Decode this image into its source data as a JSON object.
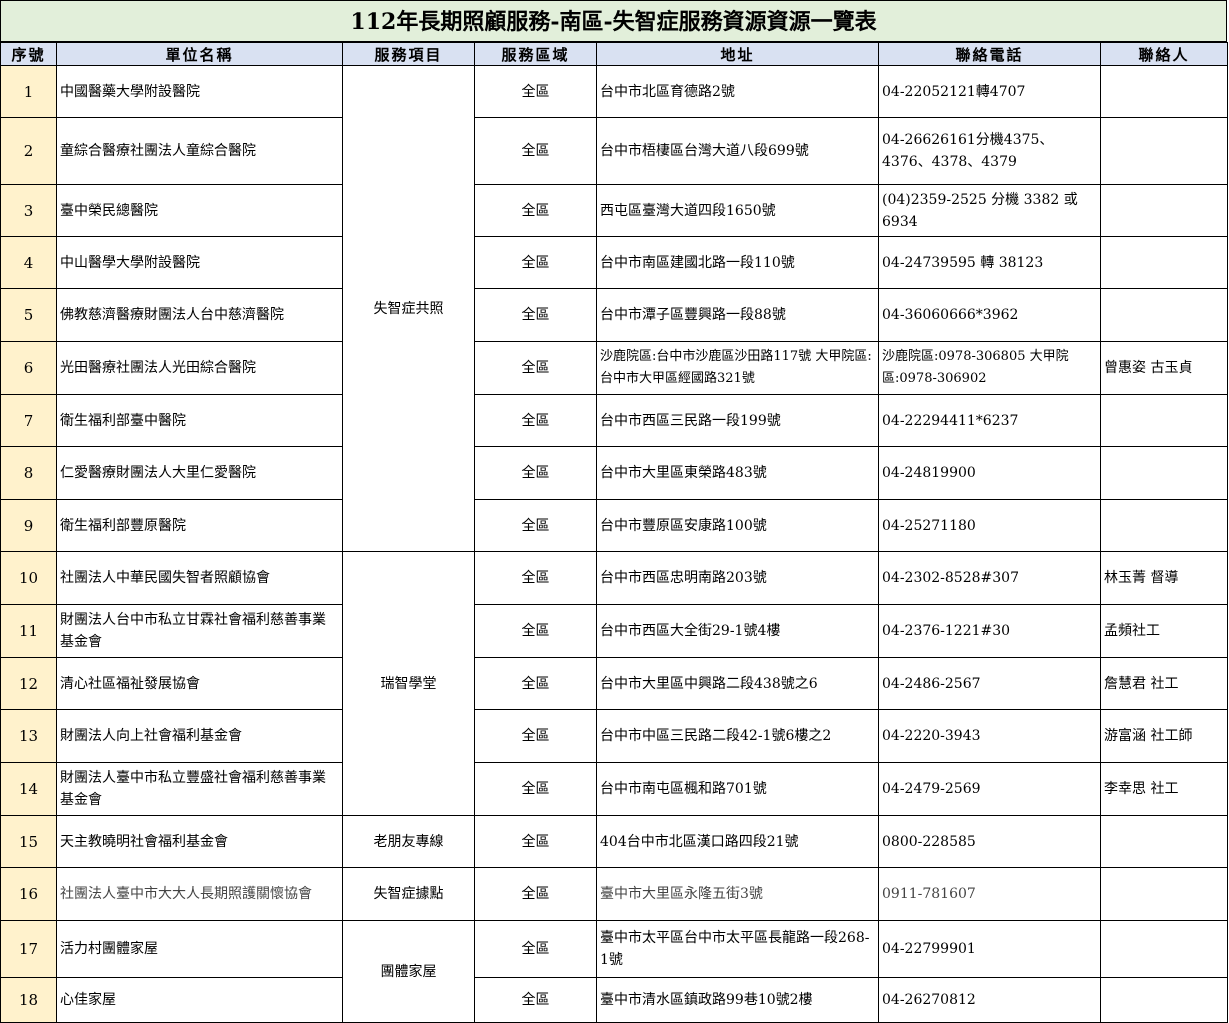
{
  "title": "112年長期照顧服務-南區-失智症服務資源資源一覽表",
  "headers": {
    "seq": "序號",
    "unit": "單位名稱",
    "service": "服務項目",
    "area": "服務區域",
    "address": "地址",
    "phone": "聯絡電話",
    "contact": "聯絡人"
  },
  "services": {
    "group1": "失智症共照",
    "group2": "瑞智學堂",
    "group3": "老朋友專線",
    "group4": "失智症據點",
    "group5": "團體家屋"
  },
  "rows": [
    {
      "seq": "1",
      "unit": "中國醫藥大學附設醫院",
      "area": "全區",
      "address": "台中市北區育德路2號",
      "phone": "04-22052121轉4707",
      "contact": ""
    },
    {
      "seq": "2",
      "unit": "童綜合醫療社團法人童綜合醫院",
      "area": "全區",
      "address": "台中市梧棲區台灣大道八段699號",
      "phone": "04-26626161分機4375、4376、4378、4379",
      "contact": ""
    },
    {
      "seq": "3",
      "unit": "臺中榮民總醫院",
      "area": "全區",
      "address": "西屯區臺灣大道四段1650號",
      "phone": "(04)2359-2525 分機 3382 或 6934",
      "contact": ""
    },
    {
      "seq": "4",
      "unit": "中山醫學大學附設醫院",
      "area": "全區",
      "address": "台中市南區建國北路一段110號",
      "phone": "04-24739595 轉 38123",
      "contact": ""
    },
    {
      "seq": "5",
      "unit": "佛教慈濟醫療財團法人台中慈濟醫院",
      "area": "全區",
      "address": "台中市潭子區豐興路一段88號",
      "phone": "04-36060666*3962",
      "contact": ""
    },
    {
      "seq": "6",
      "unit": "光田醫療社團法人光田綜合醫院",
      "area": "全區",
      "address": "沙鹿院區:台中市沙鹿區沙田路117號 大甲院區:台中市大甲區經國路321號",
      "phone": "沙鹿院區:0978-306805 大甲院區:0978-306902",
      "contact": "曾惠姿 古玉貞"
    },
    {
      "seq": "7",
      "unit": "衛生福利部臺中醫院",
      "area": "全區",
      "address": "台中市西區三民路一段199號",
      "phone": "04-22294411*6237",
      "contact": ""
    },
    {
      "seq": "8",
      "unit": "仁愛醫療財團法人大里仁愛醫院",
      "area": "全區",
      "address": "台中市大里區東榮路483號",
      "phone": "04-24819900",
      "contact": ""
    },
    {
      "seq": "9",
      "unit": "衛生福利部豐原醫院",
      "area": "全區",
      "address": "台中市豐原區安康路100號",
      "phone": "04-25271180",
      "contact": ""
    },
    {
      "seq": "10",
      "unit": "社團法人中華民國失智者照顧協會",
      "area": "全區",
      "address": "台中市西區忠明南路203號",
      "phone": "04-2302-8528#307",
      "contact": "林玉菁 督導"
    },
    {
      "seq": "11",
      "unit": "財團法人台中市私立甘霖社會福利慈善事業基金會",
      "area": "全區",
      "address": "台中市西區大全街29-1號4樓",
      "phone": "04-2376-1221#30",
      "contact": "孟頻社工"
    },
    {
      "seq": "12",
      "unit": "清心社區福祉發展協會",
      "area": "全區",
      "address": "台中市大里區中興路二段438號之6",
      "phone": "04-2486-2567",
      "contact": "詹慧君 社工"
    },
    {
      "seq": "13",
      "unit": "財團法人向上社會福利基金會",
      "area": "全區",
      "address": "台中市中區三民路二段42-1號6樓之2",
      "phone": "04-2220-3943",
      "contact": "游富涵 社工師"
    },
    {
      "seq": "14",
      "unit": "財團法人臺中市私立豐盛社會福利慈善事業基金會",
      "area": "全區",
      "address": "台中市南屯區楓和路701號",
      "phone": "04-2479-2569",
      "contact": "李幸思 社工"
    },
    {
      "seq": "15",
      "unit": "天主教曉明社會福利基金會",
      "area": "全區",
      "address": "404台中市北區漢口路四段21號",
      "phone": "0800-228585",
      "contact": ""
    },
    {
      "seq": "16",
      "unit": "社團法人臺中市大大人長期照護關懷協會",
      "area": "全區",
      "address": "臺中市大里區永隆五街3號",
      "phone": "0911-781607",
      "contact": ""
    },
    {
      "seq": "17",
      "unit": "活力村團體家屋",
      "area": "全區",
      "address": "臺中市太平區台中市太平區長龍路一段268-1號",
      "phone": "04-22799901",
      "contact": ""
    },
    {
      "seq": "18",
      "unit": "心佳家屋",
      "area": "全區",
      "address": "臺中市清水區鎮政路99巷10號2樓",
      "phone": "04-26270812",
      "contact": ""
    }
  ]
}
